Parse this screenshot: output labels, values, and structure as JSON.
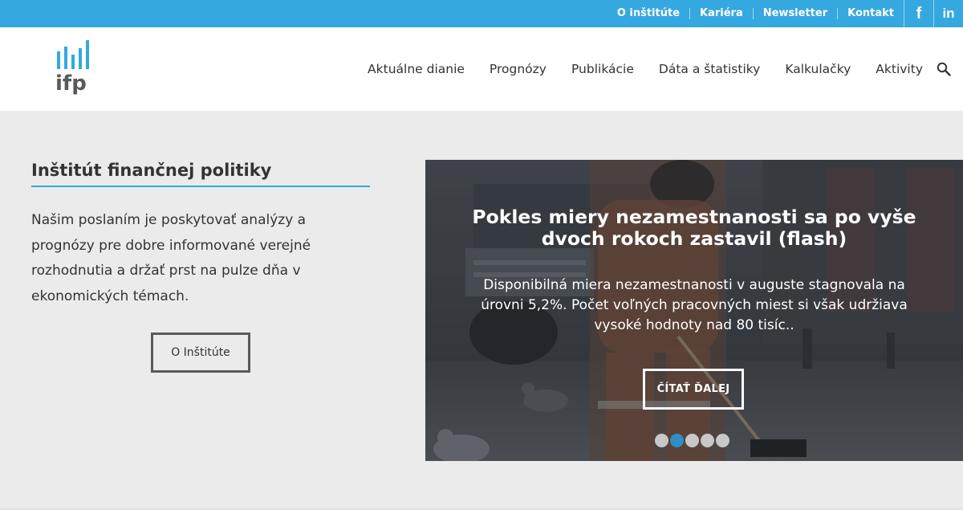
{
  "topbar": {
    "links": [
      "O inštitúte",
      "Kariéra",
      "Newsletter",
      "Kontakt"
    ],
    "social": [
      {
        "icon": "facebook-icon",
        "glyph": "f"
      },
      {
        "icon": "linkedin-icon",
        "glyph": "in"
      }
    ]
  },
  "header": {
    "logo_text": "ifp",
    "nav": [
      "Aktuálne dianie",
      "Prognózy",
      "Publikácie",
      "Dáta a štatistiky",
      "Kalkulačky",
      "Aktivity"
    ]
  },
  "intro": {
    "title": "Inštitút finančnej politiky",
    "text": "Našim poslaním je poskytovať analýzy a prognózy pre dobre informované verejné rozhodnutia a držať prst na pulze dňa v ekonomických témach.",
    "button": "O Inštitúte"
  },
  "slider": {
    "title": "Pokles miery nezamestnanosti sa po vyše dvoch rokoch zastavil (flash)",
    "text": "Disponibilná miera nezamestnanosti v auguste stagnovala na úrovni 5,2%. Počet voľných pracovných miest si však udržiava vysoké hodnoty nad 80 tisíc..",
    "button": "ČÍTAŤ ĎALEJ",
    "dots_total": 5,
    "active_dot": 2
  },
  "colors": {
    "brand_blue": "#35a8e0",
    "header_bg": "#ffffff",
    "page_bg": "#ebebeb",
    "logo_gray": "#58595b"
  }
}
